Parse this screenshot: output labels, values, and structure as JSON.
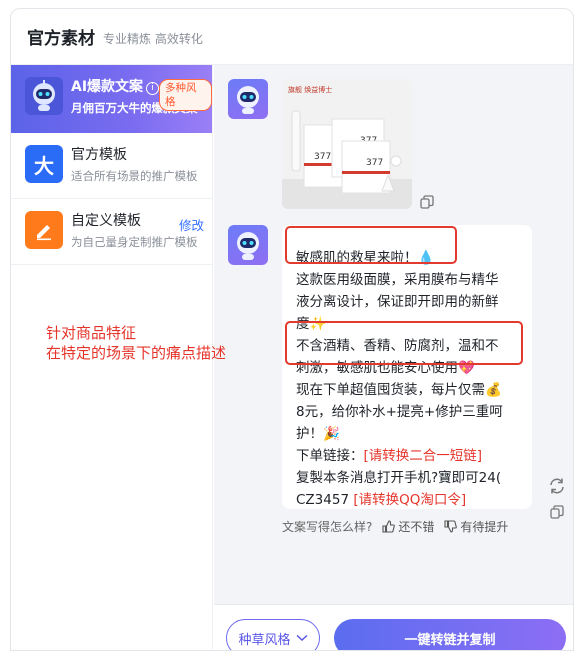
{
  "header": {
    "title": "官方素材",
    "subtitle": "专业精炼 高效转化"
  },
  "sidebar": {
    "items": [
      {
        "title": "AI爆款文案",
        "desc": "月佣百万大牛的爆款文案",
        "badge": "多种风格"
      },
      {
        "title": "官方模板",
        "desc": "适合所有场景的推广模板",
        "icon_glyph": "大"
      },
      {
        "title": "自定义模板",
        "desc": "为自己量身定制推广模板",
        "action": "修改"
      }
    ]
  },
  "product_image": {
    "brand_text": "旗舰 焕益博士",
    "box_numbers": [
      "377",
      "377",
      "377"
    ]
  },
  "message": {
    "line1": "敏感肌的救星来啦！💧",
    "line2": "这款医用级面膜，采用膜布与精华",
    "line3": "液分离设计，保证即开即用的新鲜",
    "line4": "度✨",
    "line5": "不含酒精、香精、防腐剂，温和不",
    "line6": "刺激，敏感肌也能安心使用💖",
    "line7": "现在下单超值囤货装，每片仅需💰",
    "line8": "8元，给你补水+提亮+修护三重呵",
    "line9": "护！🎉",
    "line10_prefix": "下单链接：",
    "line10_link": "[请转换二合一短链]",
    "line11": "复製本条消息打开手机?寶即可24(",
    "line12_prefix": "CZ3457 ",
    "line12_link": "[请转换QQ淘口令]"
  },
  "feedback": {
    "question": "文案写得怎么样?",
    "good": "还不错",
    "improve": "有待提升"
  },
  "bottom": {
    "style_select": "种草风格",
    "primary_button": "一键转链并复制"
  },
  "annotation": {
    "line1": "针对商品特征",
    "line2": "在特定的场景下的痛点描述"
  },
  "colors": {
    "accent": "#5b63e8",
    "highlight": "#e23a2e",
    "link_red": "#e5352b"
  }
}
